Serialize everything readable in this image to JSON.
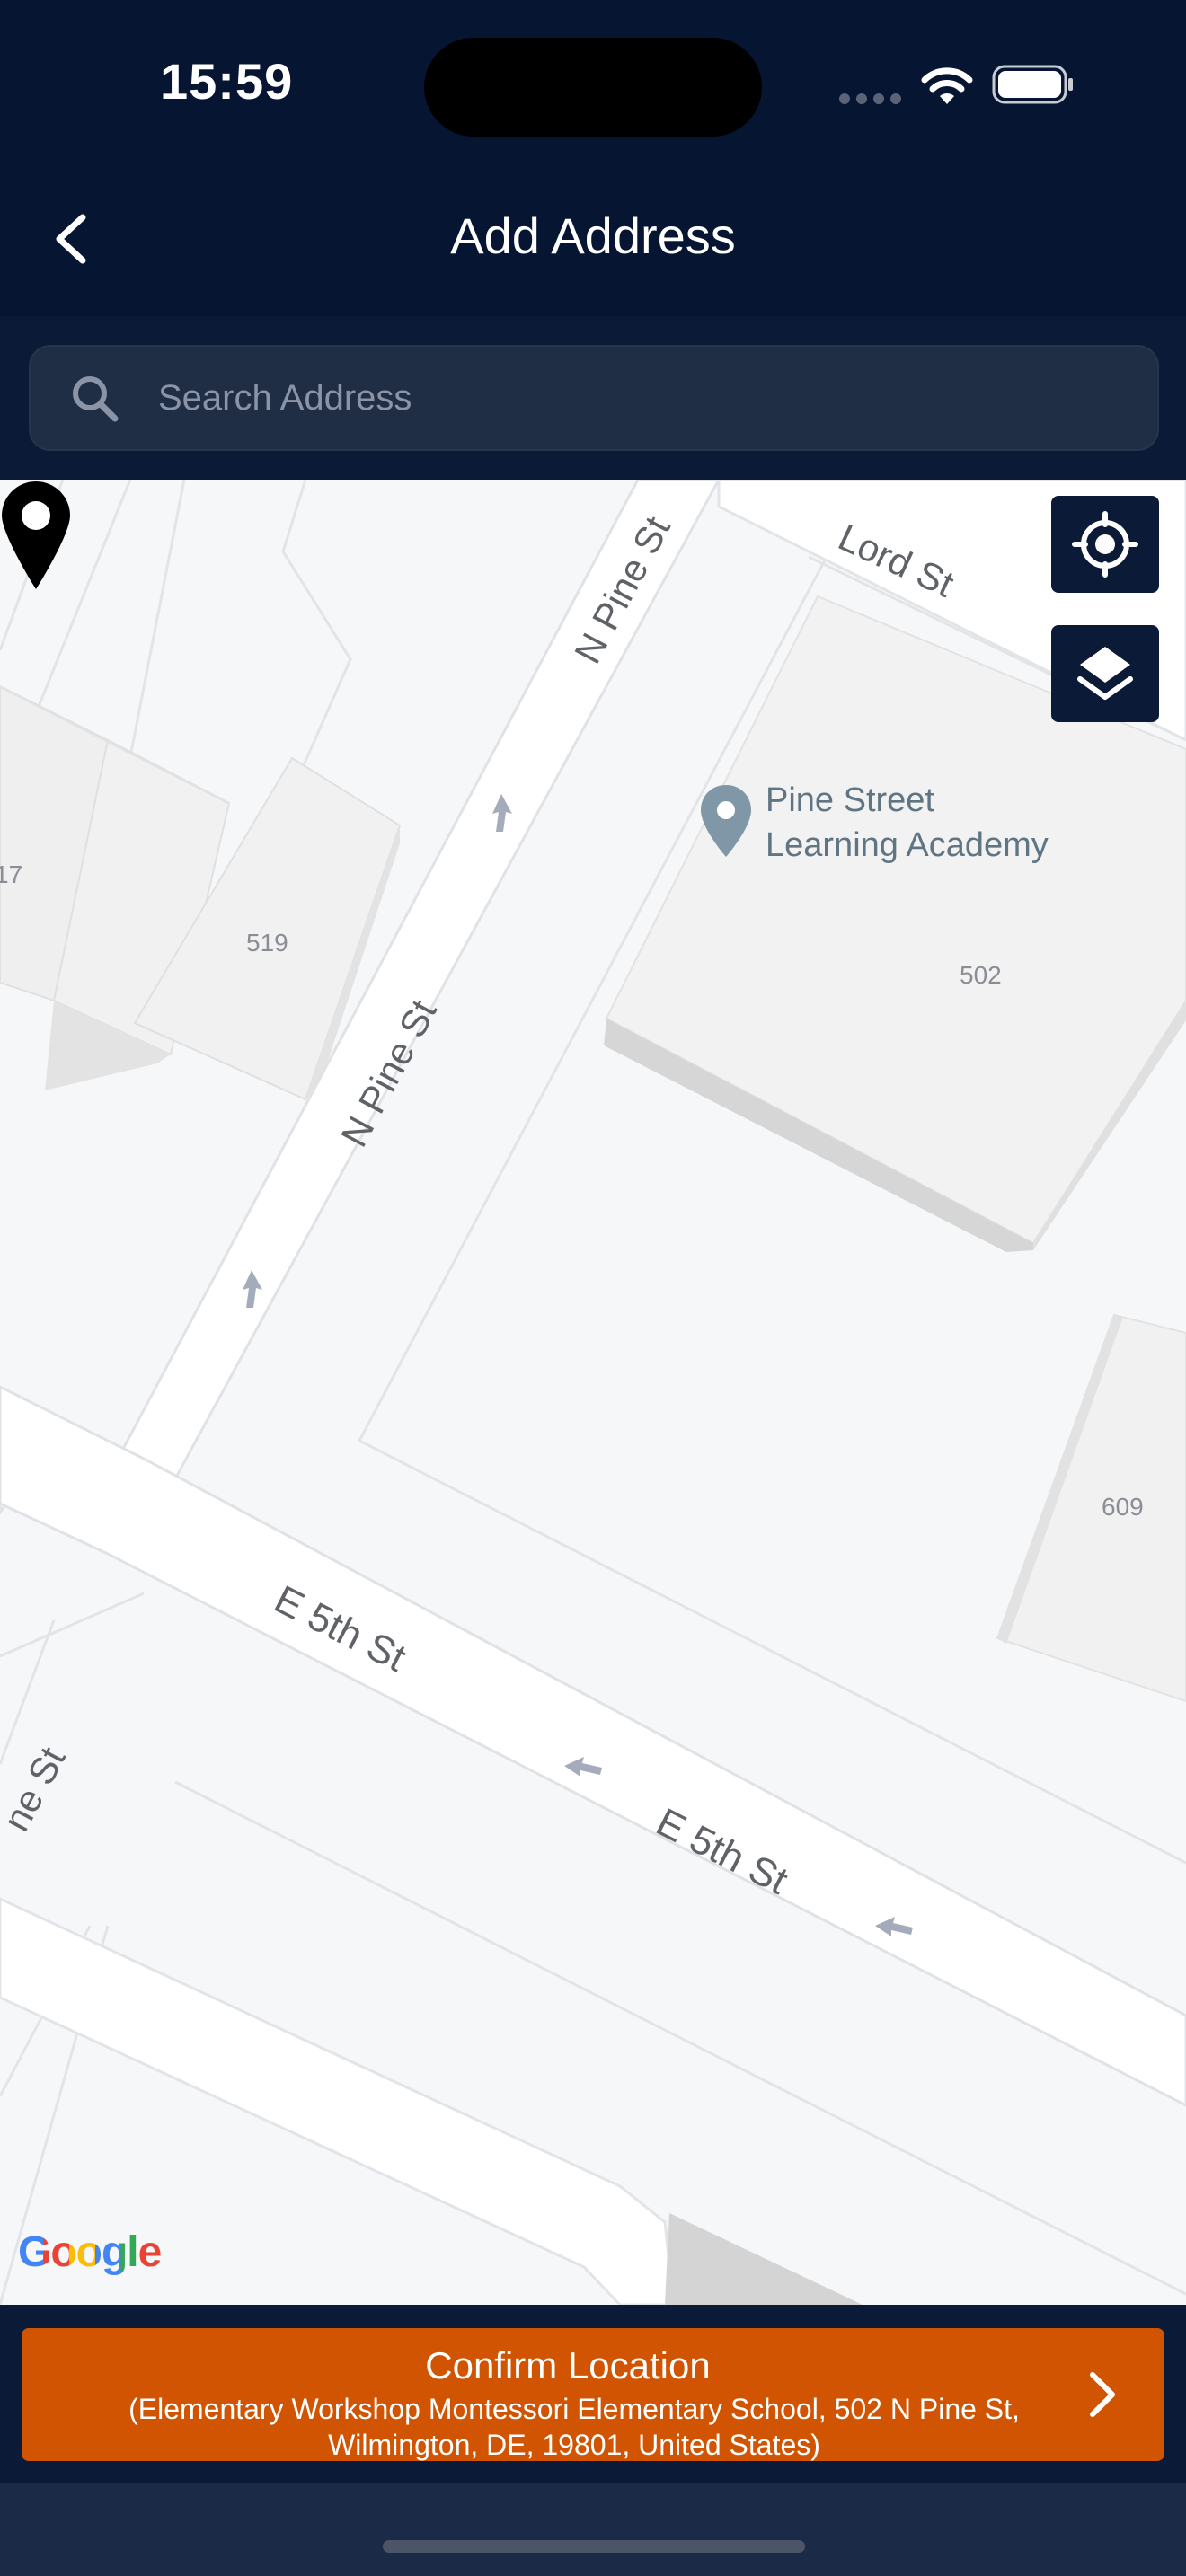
{
  "status_bar": {
    "time": "15:59"
  },
  "header": {
    "title": "Add Address",
    "back_icon": "chevron-left-icon"
  },
  "search": {
    "placeholder": "Search Address",
    "value": "",
    "icon": "search-icon"
  },
  "map": {
    "streets": [
      "Lord St",
      "N Pine St",
      "N Pine St",
      "E 5th St",
      "E 5th St",
      "ne St"
    ],
    "poi": {
      "name_line1": "Pine Street",
      "name_line2": "Learning Academy",
      "icon": "map-pin-icon"
    },
    "building_numbers": [
      "17",
      "519",
      "502",
      "609"
    ],
    "attribution": "Google",
    "controls": [
      {
        "name": "my-location",
        "icon": "crosshair-icon"
      },
      {
        "name": "map-layers",
        "icon": "layers-icon"
      }
    ],
    "marker_icon": "location-pin-icon"
  },
  "confirm": {
    "label": "Confirm Location",
    "address": "(Elementary Workshop Montessori Elementary School, 502 N Pine St, Wilmington, DE, 19801, United States)",
    "icon": "chevron-right-icon"
  },
  "colors": {
    "header_bg": "#061531",
    "confirm_button": "#d15402",
    "map_control_bg": "#0b1a36"
  }
}
